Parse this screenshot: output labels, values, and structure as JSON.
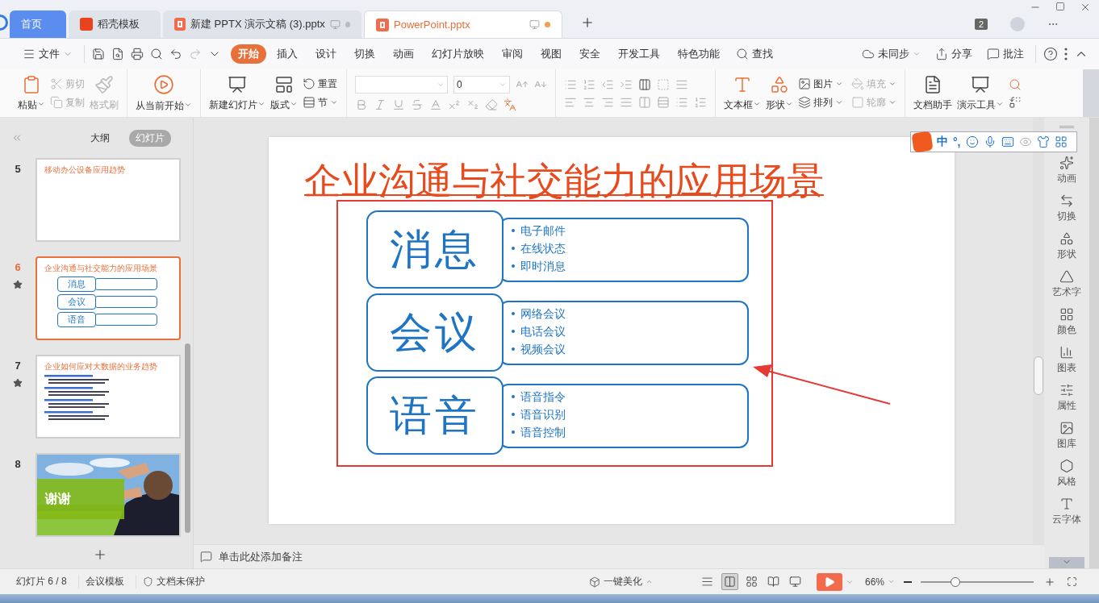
{
  "tabs": [
    {
      "label": "首页",
      "kind": "home",
      "selected": false
    },
    {
      "label": "稻壳模板",
      "kind": "docer",
      "selected": false
    },
    {
      "label": "新建 PPTX 演示文稿 (3).pptx",
      "kind": "doc",
      "selected": false
    },
    {
      "label": "PowerPoint.pptx",
      "kind": "doc",
      "selected": true
    }
  ],
  "tab_count": "2",
  "menu": {
    "file": "文件",
    "tabs": [
      {
        "label": "开始",
        "selected": true
      },
      {
        "label": "插入",
        "selected": false
      },
      {
        "label": "设计",
        "selected": false
      },
      {
        "label": "切换",
        "selected": false
      },
      {
        "label": "动画",
        "selected": false
      },
      {
        "label": "幻灯片放映",
        "selected": false
      },
      {
        "label": "审阅",
        "selected": false
      },
      {
        "label": "视图",
        "selected": false
      },
      {
        "label": "安全",
        "selected": false
      },
      {
        "label": "开发工具",
        "selected": false
      },
      {
        "label": "特色功能",
        "selected": false
      }
    ],
    "search": "查找",
    "actions": [
      {
        "label": "未同步",
        "kind": "sync"
      },
      {
        "label": "分享",
        "kind": "share"
      },
      {
        "label": "批注",
        "kind": "comment"
      }
    ]
  },
  "ribbon": {
    "paste": {
      "label": "粘贴",
      "dropdown": true
    },
    "clipboard": [
      {
        "label": "剪切",
        "disabled": true
      },
      {
        "label": "复制",
        "disabled": true
      }
    ],
    "format_painter": {
      "label": "格式刷",
      "disabled": true
    },
    "play": {
      "label": "从当前开始",
      "dropdown": true
    },
    "slide_large": [
      {
        "label": "新建幻灯片",
        "dropdown": true
      },
      {
        "label": "版式",
        "dropdown": true
      }
    ],
    "slide_small": [
      {
        "label": "重置",
        "dropdown": false
      },
      {
        "label": "节",
        "dropdown": true
      }
    ],
    "font_size": "0",
    "insert_large": [
      {
        "label": "文本框",
        "dropdown": true
      },
      {
        "label": "形状",
        "dropdown": true
      }
    ],
    "insert_small": [
      {
        "label": "图片",
        "dropdown": true,
        "disabled": false
      },
      {
        "label": "填充",
        "dropdown": true,
        "disabled": true
      },
      {
        "label": "排列",
        "dropdown": true,
        "disabled": false
      },
      {
        "label": "轮廓",
        "dropdown": true,
        "disabled": true
      }
    ],
    "tools": [
      {
        "label": "文档助手",
        "dropdown": false
      },
      {
        "label": "演示工具",
        "dropdown": true
      }
    ]
  },
  "panel": {
    "tabs": [
      {
        "label": "大纲",
        "selected": false
      },
      {
        "label": "幻灯片",
        "selected": true
      }
    ],
    "slides": [
      {
        "number": "5",
        "kind": "title",
        "title": "移动办公设备应用趋势",
        "selected": false,
        "starred": false
      },
      {
        "number": "6",
        "kind": "diagram",
        "title": "企业沟通与社交能力的应用场景",
        "labels": [
          "消息",
          "会议",
          "语音"
        ],
        "selected": true,
        "starred": true
      },
      {
        "number": "7",
        "kind": "bullets",
        "title": "企业如何应对大数据的业务趋势",
        "selected": false,
        "starred": true
      },
      {
        "number": "8",
        "caption": "谢谢",
        "selected": false,
        "starred": false
      }
    ]
  },
  "slide": {
    "title": "企业沟通与社交能力的应用场景",
    "rows": [
      {
        "label": "消息",
        "items": [
          "电子邮件",
          "在线状态",
          "即时消息"
        ]
      },
      {
        "label": "会议",
        "items": [
          "网络会议",
          "电话会议",
          "视频会议"
        ]
      },
      {
        "label": "语音",
        "items": [
          "语音指令",
          "语音识别",
          "语音控制"
        ]
      }
    ]
  },
  "ime": {
    "mode": "中",
    "punct": "°,"
  },
  "notes": {
    "placeholder": "单击此处添加备注"
  },
  "sidebar": [
    "动画",
    "切换",
    "形状",
    "艺术字",
    "颜色",
    "图表",
    "属性",
    "图库",
    "风格",
    "云字体"
  ],
  "status": {
    "counter": "幻灯片 6 / 8",
    "template": "会议模板",
    "protection": "文档未保护",
    "beautify": "一键美化",
    "views": [
      {
        "kind": "normal",
        "selected": true
      },
      {
        "kind": "sorter",
        "selected": false
      },
      {
        "kind": "reading",
        "selected": false
      },
      {
        "kind": "presenter",
        "selected": false
      }
    ],
    "zoom": "66%",
    "zoom_slider": {
      "level": 0.31
    }
  }
}
